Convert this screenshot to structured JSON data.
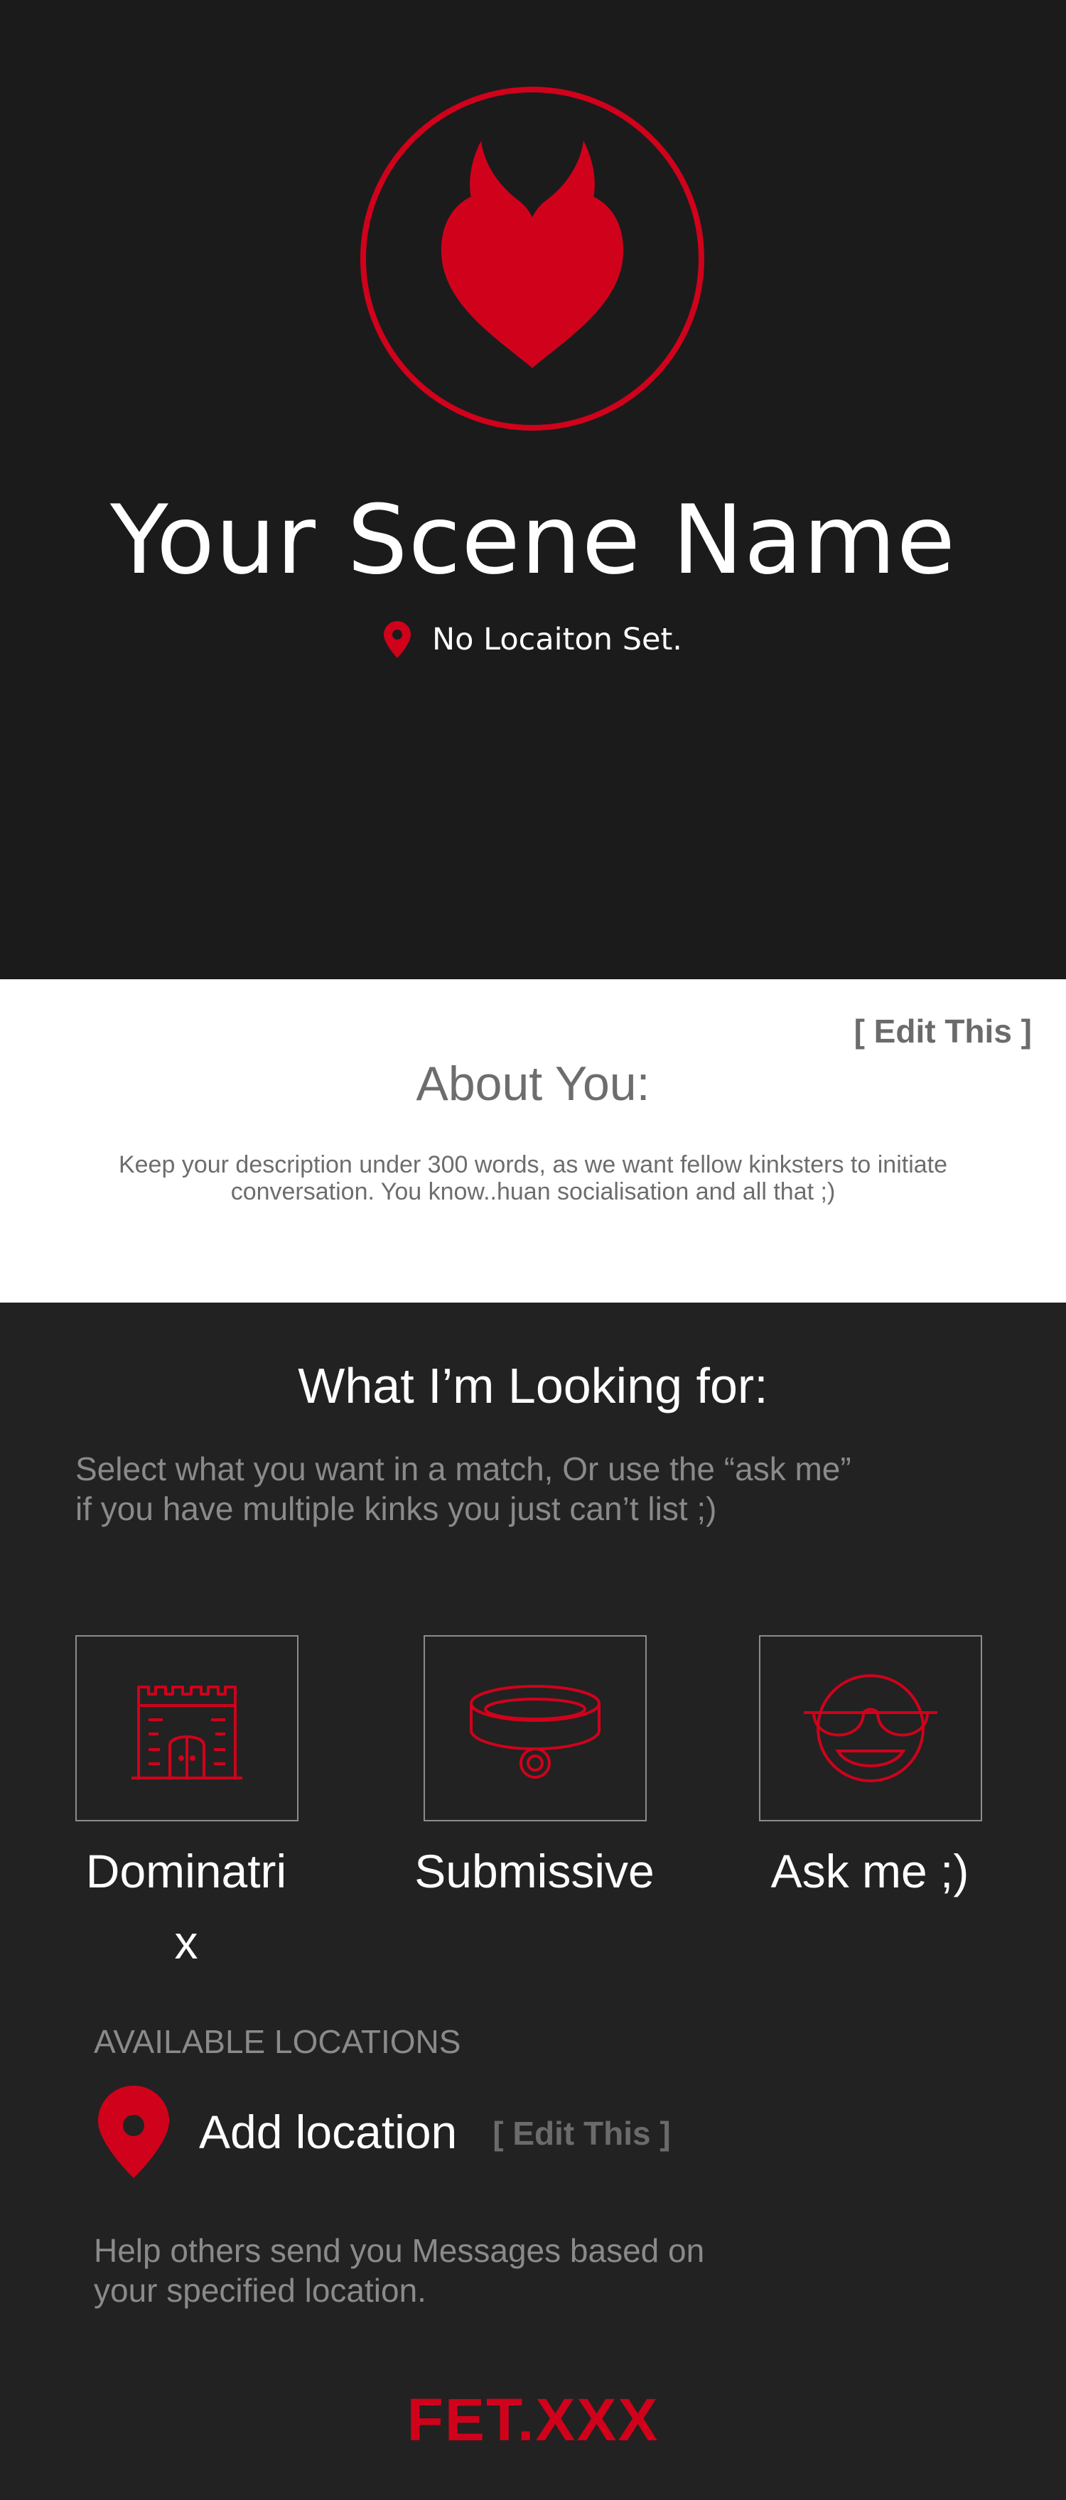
{
  "header": {
    "scene_name": "Your Scene Name",
    "location_text": "No Locaiton Set.",
    "avatar_icon": "devil-heart-icon",
    "location_icon": "map-pin-icon"
  },
  "about": {
    "edit_label": "[ Edit This ]",
    "title": "About You:",
    "description": "Keep your description under 300 words, as we want fellow kinksters to initiate conversation. You know..huan socialisation and all that ;)"
  },
  "looking_for": {
    "title": "What I’m Looking for:",
    "subtitle_line1": "Select what you want in a match, Or use the “ask me”",
    "subtitle_line2": "if you have multiple kinks you just can’t list ;)",
    "options": [
      {
        "label": "Dominatrix",
        "icon": "castle-icon"
      },
      {
        "label": "Submissive",
        "icon": "collar-icon"
      },
      {
        "label": "Ask me ;)",
        "icon": "sunglasses-smiley-icon"
      }
    ]
  },
  "locations": {
    "heading": "AVAILABLE LOCATIONS",
    "add_label": "Add location",
    "edit_label": "[ Edit This ]",
    "help_line1": "Help others send you Messages based on",
    "help_line2": "your specified location.",
    "icon": "map-pin-icon"
  },
  "brand": {
    "logo": "FET.XXX"
  },
  "colors": {
    "accent": "#d0021b",
    "header_bg": "#1b1b1c",
    "section_bg": "#222222",
    "muted_text": "#8a8a8a",
    "about_bg": "#ffffff"
  }
}
